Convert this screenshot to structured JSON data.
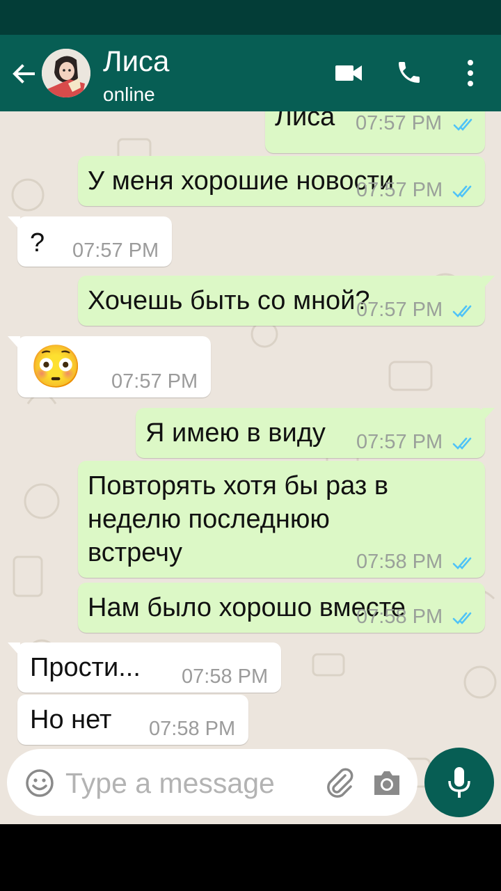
{
  "header": {
    "contact_name": "Лиса",
    "contact_status": "online"
  },
  "icons": {
    "back": "arrow-left-icon",
    "video": "video-call-icon",
    "phone": "phone-icon",
    "menu": "more-vert-icon",
    "emoji": "emoji-icon",
    "attach": "paperclip-icon",
    "camera": "camera-icon",
    "mic": "mic-icon",
    "read": "double-check-icon"
  },
  "messages": [
    {
      "dir": "out",
      "text": "Лиса",
      "time": "07:57 PM",
      "read": true
    },
    {
      "dir": "out",
      "text": "У меня хорошие новости",
      "time": "07:57 PM",
      "read": true
    },
    {
      "dir": "in",
      "text": "?",
      "time": "07:57 PM"
    },
    {
      "dir": "out",
      "text": "Хочешь быть со мной?",
      "time": "07:57 PM",
      "read": true
    },
    {
      "dir": "in",
      "text": "😳",
      "time": "07:57 PM"
    },
    {
      "dir": "out",
      "text": "Я имею в виду",
      "time": "07:57 PM",
      "read": true
    },
    {
      "dir": "out",
      "lines": [
        "Повторять хотя бы раз в",
        "неделю последнюю",
        "встречу"
      ],
      "time": "07:58 PM",
      "read": true
    },
    {
      "dir": "out",
      "text": "Нам было хорошо вместе",
      "time": "07:58 PM",
      "read": true
    },
    {
      "dir": "in",
      "text": "Прости...",
      "time": "07:58 PM"
    },
    {
      "dir": "in",
      "text": "Но нет",
      "time": "07:58 PM"
    }
  ],
  "input": {
    "placeholder": "Type a message",
    "value": ""
  },
  "colors": {
    "header": "#075e54",
    "status_bar": "#033d37",
    "outgoing_bubble": "#dcf8c6",
    "incoming_bubble": "#ffffff",
    "chat_background": "#ece5dd",
    "read_ticks": "#4fc3f7"
  }
}
